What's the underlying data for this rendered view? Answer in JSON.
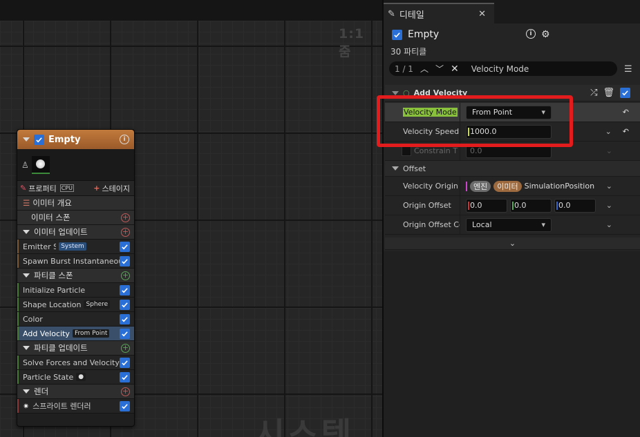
{
  "graph": {
    "zoom_label": "1:1 줌",
    "watermark": "시스템"
  },
  "node": {
    "title": "Empty",
    "tab_properties": "프로퍼티",
    "tab_cpu": "CPU",
    "tab_stage": "스테이지",
    "emitter_summary": "이미터 개요",
    "emitter_spawn": "이미터 스폰",
    "emitter_update": "이미터 업데이트",
    "emitter_state": "Emitter State",
    "emitter_state_badge": "System",
    "spawn_burst": "Spawn Burst Instantaneous",
    "particle_spawn": "파티클 스폰",
    "initialize_particle": "Initialize Particle",
    "shape_location": "Shape Location",
    "shape_location_badge": "Sphere",
    "color": "Color",
    "add_velocity": "Add Velocity",
    "add_velocity_badge": "From Point",
    "particle_update": "파티클 업데이트",
    "solve_forces": "Solve Forces and Velocity",
    "particle_state": "Particle State",
    "render": "렌더",
    "sprite_renderer": "스프라이트 렌더러"
  },
  "details": {
    "tab_title": "디테일",
    "object_name": "Empty",
    "particle_count": "30 파티클",
    "search_counter": "1 / 1",
    "search_query": "Velocity Mode",
    "section_add_velocity": "Add Velocity",
    "velocity_mode_label": "Velocity Mode",
    "velocity_mode_value": "From Point",
    "velocity_speed_label": "Velocity Speed",
    "velocity_speed_value": "1000.0",
    "constrain_label": "Constrain T",
    "constrain_value": "0.0",
    "offset_section": "Offset",
    "velocity_origin_label": "Velocity Origin",
    "origin_pill_engine": "엔진",
    "origin_pill_emitter": "이미터",
    "origin_value": "SimulationPosition",
    "origin_offset_label": "Origin Offset",
    "origin_offset_x": "0.0",
    "origin_offset_y": "0.0",
    "origin_offset_z": "0.0",
    "origin_offset_coord_label": "Origin Offset Co",
    "origin_offset_coord_value": "Local"
  },
  "colors": {
    "accent_blue": "#2a6fd6",
    "highlight_green": "#8ac13c",
    "annotation_red": "#e21c1c",
    "node_header": "#c27a3c"
  }
}
